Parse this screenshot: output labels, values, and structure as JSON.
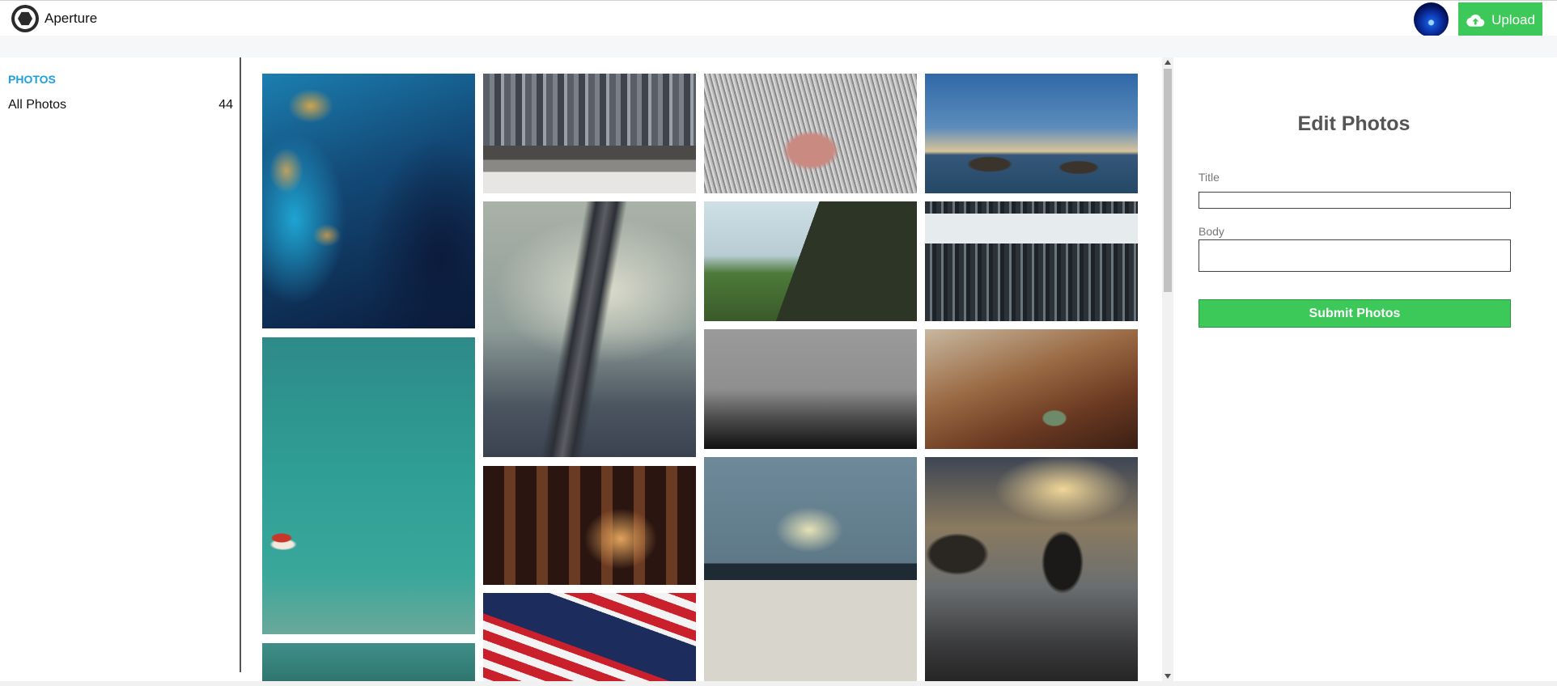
{
  "app": {
    "title": "Aperture",
    "logo_icon": "aperture-logo-icon",
    "upload_label": "Upload",
    "upload_icon": "cloud-upload-icon",
    "accent_color": "#3dc95a",
    "link_color": "#1ca0e0"
  },
  "sidebar": {
    "heading": "PHOTOS",
    "items": [
      {
        "label": "All Photos",
        "count": "44"
      }
    ]
  },
  "gallery": {
    "photos": [
      {
        "subject": "aerial ocean and coral reef"
      },
      {
        "subject": "city skyline with person on bench"
      },
      {
        "subject": "close-up cat nose"
      },
      {
        "subject": "ocean waves at sunset"
      },
      {
        "subject": "foggy forest with railroad tracks"
      },
      {
        "subject": "cliff road through green hills"
      },
      {
        "subject": "skyscrapers looking up"
      },
      {
        "subject": "foggy treeline"
      },
      {
        "subject": "cafe table with coffee cup"
      },
      {
        "subject": "turquoise water with red boat"
      },
      {
        "subject": "arched monastery corridor"
      },
      {
        "subject": "desk papers blurred"
      },
      {
        "subject": "rocky coast at dusk"
      },
      {
        "subject": "american flag and helicopter"
      },
      {
        "subject": "teal water partial"
      }
    ]
  },
  "edit_panel": {
    "title": "Edit Photos",
    "title_label": "Title",
    "title_value": "",
    "body_label": "Body",
    "body_value": "",
    "submit_label": "Submit Photos"
  }
}
